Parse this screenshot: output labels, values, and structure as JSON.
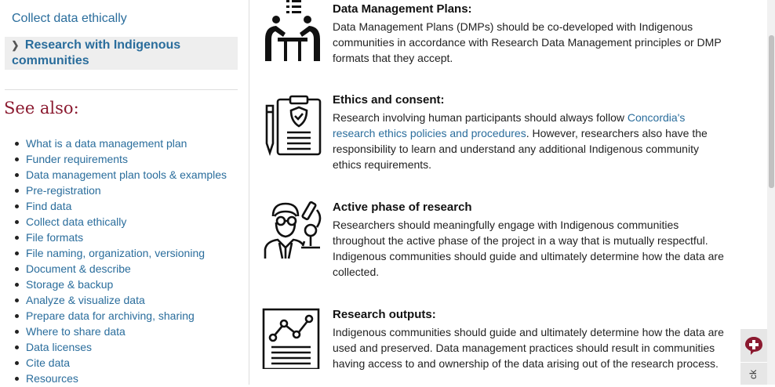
{
  "sidebar": {
    "collect_link": "Collect data ethically",
    "active_item": {
      "line1": "Research with Indigenous",
      "line2": "communities"
    },
    "see_also_heading": "See also:",
    "links": [
      "What is a data management plan",
      "Funder requirements",
      "Data management plan tools & examples",
      "Pre-registration",
      "Find data",
      "Collect data ethically",
      "File formats",
      "File naming, organization, versioning",
      "Document & describe",
      "Storage & backup",
      "Analyze & visualize data",
      "Prepare data for archiving, sharing",
      "Where to share data",
      "Data licenses",
      "Cite data",
      "Resources"
    ]
  },
  "sections": [
    {
      "icon": "meeting-icon",
      "title": "Data Management Plans:",
      "lines": [
        "Data Management Plans (DMPs) should be co-developed with Indigenous",
        "communities in accordance with Research Data Management principles or DMP",
        "formats that they accept."
      ]
    },
    {
      "icon": "clipboard-shield-icon",
      "title": "Ethics and consent:",
      "line1_text": "Research involving human participants should always follow ",
      "line1_link": "Concordia's",
      "line2_link": "research ethics policies and procedures",
      "line2_text": ". However, researchers also have the",
      "lines_rest": [
        "responsibility to learn and understand any additional Indigenous community",
        "ethics requirements."
      ]
    },
    {
      "icon": "scientist-icon",
      "title": "Active phase of research",
      "lines": [
        "Researchers should meaningfully engage with Indigenous communities",
        "throughout the active phase of the project in a way that is mutually respectful.",
        "Indigenous communities should guide and ultimately determine how the data are",
        "collected."
      ]
    },
    {
      "icon": "report-chart-icon",
      "title": "Research outputs:",
      "lines": [
        "Indigenous communities should guide and ultimately determine how the data are",
        "used and preserved. Data management practices should result in communities",
        "having access to and ownership of the data arising out of the research process."
      ]
    }
  ],
  "feedback": {
    "icon": "plus-badge-icon",
    "tab_text": "ck"
  },
  "colors": {
    "link": "#2a6d9c",
    "heading": "#8b1a30",
    "feedback_icon": "#8b1a30"
  }
}
